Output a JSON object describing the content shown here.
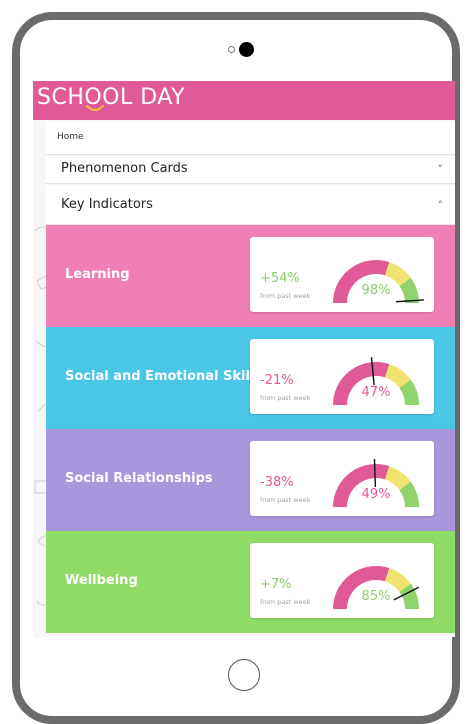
{
  "app": {
    "logo_text": "SCHOOL DAY"
  },
  "breadcrumb": {
    "home": "Home"
  },
  "accordion": [
    {
      "label": "Phenomenon Cards",
      "chevron": "˅",
      "expanded": false
    },
    {
      "label": "Key Indicators",
      "chevron": "˄",
      "expanded": true
    }
  ],
  "indicators": [
    {
      "title": "Learning",
      "change": "+54%",
      "change_sub": "from past week",
      "value": "98%",
      "fraction": 0.98,
      "bg": "#f07fb5",
      "change_color": "#8bd06a",
      "value_color": "#8bd06a"
    },
    {
      "title": "Social and Emotional Skills",
      "change": "-21%",
      "change_sub": "from past week",
      "value": "47%",
      "fraction": 0.47,
      "bg": "#4cc6e6",
      "change_color": "#e05a97",
      "value_color": "#e05a97"
    },
    {
      "title": "Social Relationships",
      "change": "-38%",
      "change_sub": "from past week",
      "value": "49%",
      "fraction": 0.49,
      "bg": "#a997de",
      "change_color": "#e05a97",
      "value_color": "#e05a97"
    },
    {
      "title": "Wellbeing",
      "change": "+7%",
      "change_sub": "from past week",
      "value": "85%",
      "fraction": 0.85,
      "bg": "#8edc66",
      "change_color": "#8bd06a",
      "value_color": "#8bd06a"
    }
  ],
  "gauge_colors": {
    "pink": "#e05a97",
    "yellow": "#f1e36f",
    "green": "#8fd36c",
    "needle": "#111111"
  },
  "device": {
    "frame_color": "#6b6b6b"
  }
}
